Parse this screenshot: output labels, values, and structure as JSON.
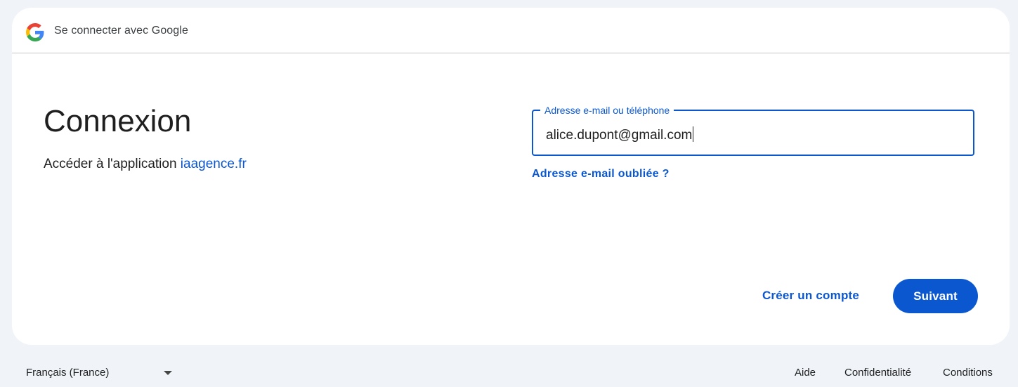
{
  "header": {
    "title": "Se connecter avec Google"
  },
  "main": {
    "heading": "Connexion",
    "subtitle_prefix": "Accéder à l'application ",
    "app_link": "iaagence.fr"
  },
  "form": {
    "email_label": "Adresse e-mail ou téléphone",
    "email_value": "alice.dupont@gmail.com",
    "forgot_link": "Adresse e-mail oubliée ?"
  },
  "actions": {
    "create_account": "Créer un compte",
    "next": "Suivant"
  },
  "footer": {
    "language": "Français (France)",
    "links": [
      "Aide",
      "Confidentialité",
      "Conditions"
    ]
  },
  "colors": {
    "accent": "#0b57d0",
    "background": "#f0f4f9",
    "card": "#ffffff"
  },
  "icons": {
    "logo": "google-g-icon",
    "dropdown": "chevron-down-icon"
  }
}
